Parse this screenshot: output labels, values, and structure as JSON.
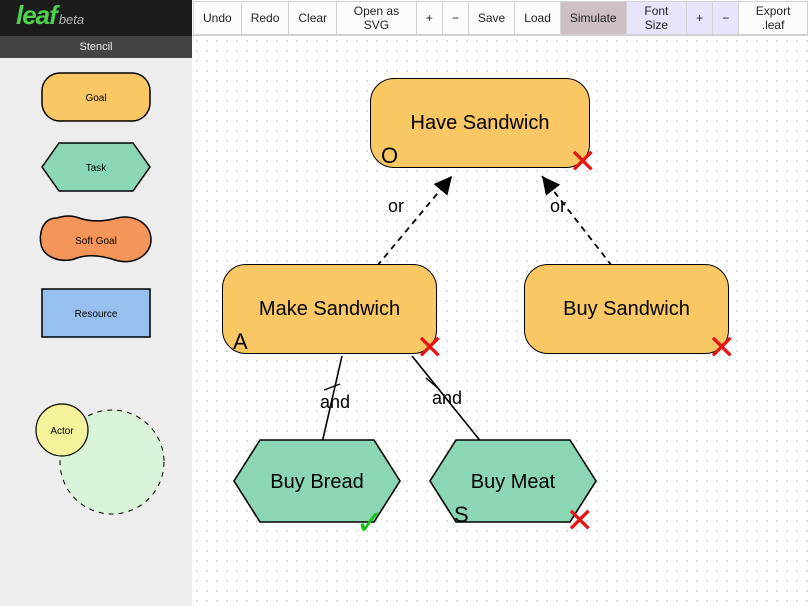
{
  "app": {
    "logo_text": "leaf",
    "logo_suffix": "beta",
    "sidebar_title": "Stencil"
  },
  "toolbar": {
    "undo": "Undo",
    "redo": "Redo",
    "clear": "Clear",
    "open_svg": "Open as SVG",
    "zoom_in": "+",
    "zoom_out": "−",
    "save": "Save",
    "load": "Load",
    "simulate": "Simulate",
    "font_size": "Font Size",
    "font_inc": "+",
    "font_dec": "−",
    "export_leaf": "Export .leaf"
  },
  "stencils": {
    "goal": "Goal",
    "task": "Task",
    "soft_goal": "Soft Goal",
    "resource": "Resource",
    "actor": "Actor"
  },
  "nodes": {
    "have_sandwich": {
      "label": "Have Sandwich",
      "type": "goal",
      "anno_left": "O",
      "status": "fail"
    },
    "make_sandwich": {
      "label": "Make Sandwich",
      "type": "goal",
      "anno_left": "A",
      "status": "fail"
    },
    "buy_sandwich": {
      "label": "Buy Sandwich",
      "type": "goal",
      "status": "fail"
    },
    "buy_bread": {
      "label": "Buy Bread",
      "type": "task",
      "status": "ok"
    },
    "buy_meat": {
      "label": "Buy Meat",
      "type": "task",
      "anno_left": "S",
      "status": "fail"
    }
  },
  "edges": {
    "make_to_have": {
      "label": "or"
    },
    "buy_to_have": {
      "label": "or"
    },
    "bread_to_make": {
      "label": "and"
    },
    "meat_to_make": {
      "label": "and"
    }
  },
  "colors": {
    "goal_fill": "#f9c763",
    "task_fill": "#8bd6b5",
    "softgoal_fill": "#f4955a",
    "resource_fill": "#98c0ef",
    "actor_fill": "#f4f39b",
    "boundary_fill": "#d9f3d8"
  },
  "marks": {
    "fail": "✕",
    "ok": "✓"
  }
}
